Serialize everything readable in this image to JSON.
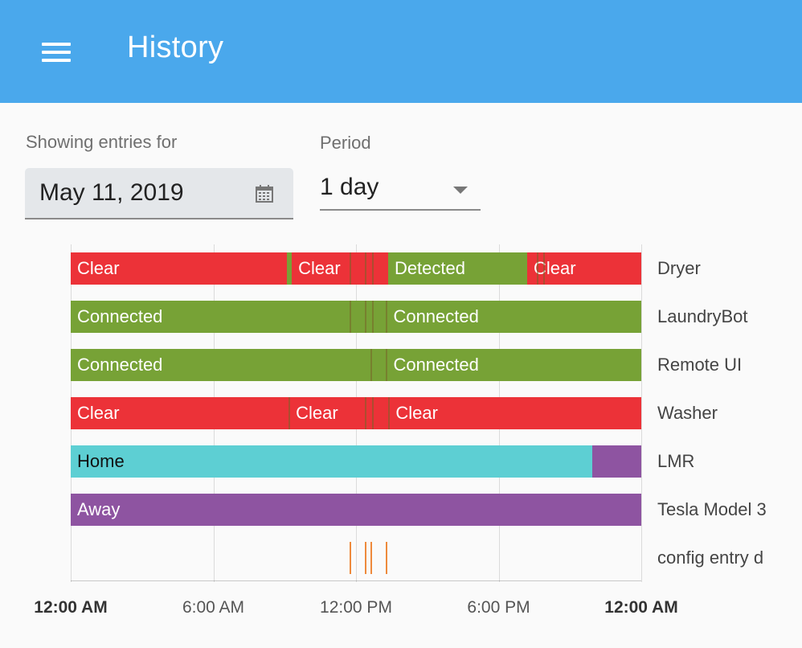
{
  "app": {
    "title": "History"
  },
  "filters": {
    "showing_label": "Showing entries for",
    "date_value": "May 11, 2019",
    "period_label": "Period",
    "period_value": "1 day"
  },
  "colors": {
    "app_bar": "#4aa8ec",
    "clear_red": "#ec3238",
    "ok_green": "#77a236",
    "home_cyan": "#5dcfd3",
    "away_purple": "#8e54a1",
    "marker_orange": "#ee8a3c"
  },
  "timeline": {
    "x_ticks": [
      "12:00 AM",
      "6:00 AM",
      "12:00 PM",
      "6:00 PM",
      "12:00 AM"
    ],
    "x_tick_bold": [
      true,
      false,
      false,
      false,
      true
    ],
    "range_hours": [
      0,
      24
    ],
    "rows": [
      {
        "name": "Dryer",
        "segments": [
          {
            "start": 0,
            "end": 9.1,
            "label": "Clear",
            "color": "#ec3238"
          },
          {
            "start": 9.1,
            "end": 9.3,
            "label": "",
            "color": "#77a236"
          },
          {
            "start": 9.3,
            "end": 13.35,
            "label": "Clear",
            "color": "#ec3238"
          },
          {
            "start": 13.35,
            "end": 19.2,
            "label": "Detected",
            "color": "#77a236"
          },
          {
            "start": 19.2,
            "end": 24,
            "label": "Clear",
            "color": "#ec3238"
          }
        ],
        "markers": [
          11.75,
          12.4,
          12.7,
          19.65,
          19.9
        ]
      },
      {
        "name": "LaundryBot",
        "segments": [
          {
            "start": 0,
            "end": 13.3,
            "label": "Connected",
            "color": "#77a236"
          },
          {
            "start": 13.3,
            "end": 24,
            "label": "Connected",
            "color": "#77a236"
          }
        ],
        "markers": [
          11.75,
          12.4,
          12.7,
          13.3
        ]
      },
      {
        "name": "Remote UI",
        "segments": [
          {
            "start": 0,
            "end": 13.3,
            "label": "Connected",
            "color": "#77a236"
          },
          {
            "start": 13.3,
            "end": 24,
            "label": "Connected",
            "color": "#77a236"
          }
        ],
        "markers": [
          12.65,
          13.3
        ]
      },
      {
        "name": "Washer",
        "segments": [
          {
            "start": 0,
            "end": 9.2,
            "label": "Clear",
            "color": "#ec3238"
          },
          {
            "start": 9.2,
            "end": 13.4,
            "label": "Clear",
            "color": "#ec3238"
          },
          {
            "start": 13.4,
            "end": 24,
            "label": "Clear",
            "color": "#ec3238"
          }
        ],
        "markers": [
          9.2,
          12.4,
          12.7,
          13.4
        ]
      },
      {
        "name": "LMR",
        "segments": [
          {
            "start": 0,
            "end": 21.95,
            "label": "Home",
            "color": "#5dcfd3",
            "dark": true
          },
          {
            "start": 21.95,
            "end": 24,
            "label": "",
            "color": "#8e54a1"
          }
        ],
        "markers": []
      },
      {
        "name": "Tesla Model 3",
        "segments": [
          {
            "start": 0,
            "end": 24,
            "label": "Away",
            "color": "#8e54a1"
          }
        ],
        "markers": []
      },
      {
        "name": "config entry d",
        "segments": [],
        "events": [
          11.75,
          12.4,
          12.65,
          13.3
        ]
      }
    ]
  }
}
